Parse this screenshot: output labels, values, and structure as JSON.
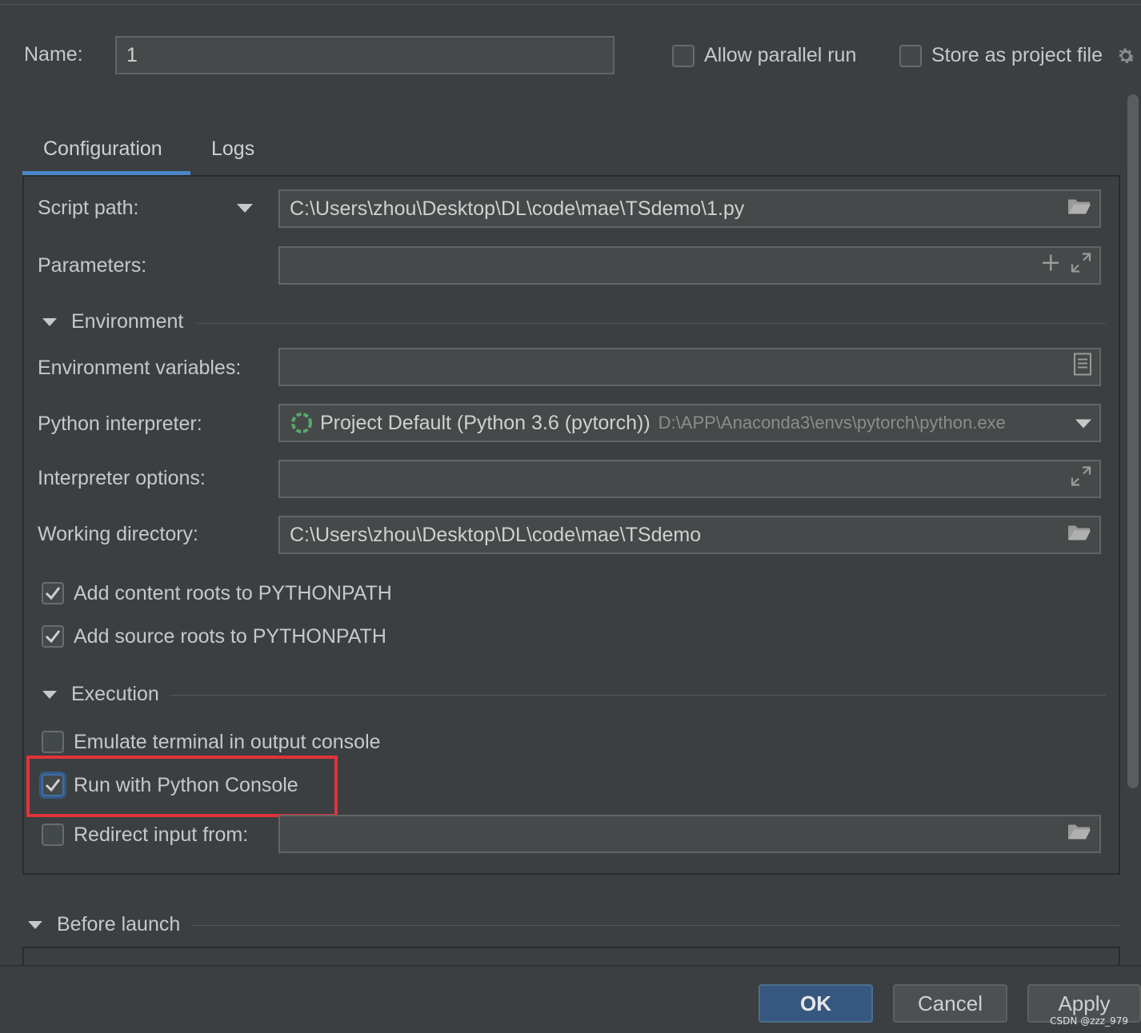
{
  "header": {
    "name_label": "Name:",
    "name_value": "1",
    "allow_parallel_label": "Allow parallel run",
    "allow_parallel_checked": false,
    "store_project_label": "Store as project file",
    "store_project_checked": false
  },
  "tabs": [
    {
      "label": "Configuration",
      "active": true
    },
    {
      "label": "Logs",
      "active": false
    }
  ],
  "form": {
    "script_path_label": "Script path:",
    "script_path_value": "C:\\Users\\zhou\\Desktop\\DL\\code\\mae\\TSdemo\\1.py",
    "parameters_label": "Parameters:",
    "parameters_value": "",
    "environment_section": "Environment",
    "env_vars_label": "Environment variables:",
    "env_vars_value": "",
    "interpreter_label": "Python interpreter:",
    "interpreter_name": "Project Default (Python 3.6 (pytorch))",
    "interpreter_path": "D:\\APP\\Anaconda3\\envs\\pytorch\\python.exe",
    "interp_options_label": "Interpreter options:",
    "interp_options_value": "",
    "working_dir_label": "Working directory:",
    "working_dir_value": "C:\\Users\\zhou\\Desktop\\DL\\code\\mae\\TSdemo",
    "content_roots_label": "Add content roots to PYTHONPATH",
    "content_roots_checked": true,
    "source_roots_label": "Add source roots to PYTHONPATH",
    "source_roots_checked": true,
    "execution_section": "Execution",
    "emulate_terminal_label": "Emulate terminal in output console",
    "emulate_terminal_checked": false,
    "python_console_label": "Run with Python Console",
    "python_console_checked": true,
    "redirect_input_label": "Redirect input from:",
    "redirect_input_checked": false,
    "redirect_input_value": ""
  },
  "before_launch": {
    "section": "Before launch"
  },
  "buttons": {
    "ok": "OK",
    "cancel": "Cancel",
    "apply": "Apply"
  },
  "watermark": "CSDN @zzz_979",
  "colors": {
    "background": "#3c3f41",
    "field_bg": "#45494a",
    "accent": "#4a88c7",
    "ok_button": "#365880",
    "highlight_box": "#e0333a",
    "interpreter_icon": "#59a869"
  },
  "icons": [
    "gear-icon",
    "folder-icon",
    "plus-icon",
    "expand-icon",
    "document-icon",
    "chevron-down-icon",
    "python-interpreter-icon",
    "checkmark-icon"
  ]
}
